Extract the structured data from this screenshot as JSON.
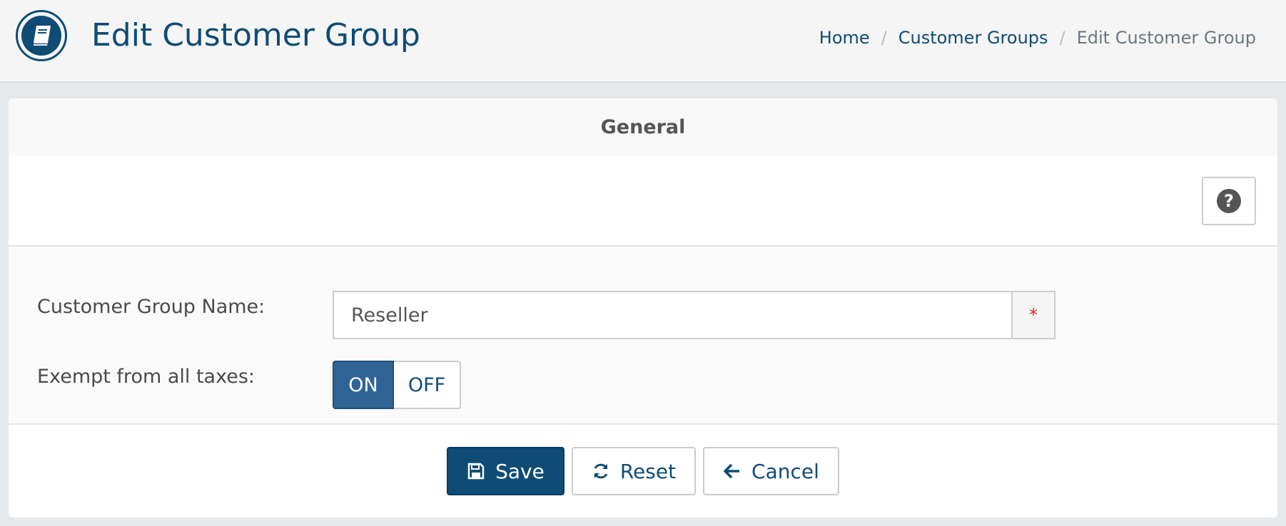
{
  "header": {
    "logo_icon": "book-icon",
    "title": "Edit Customer Group",
    "breadcrumb": [
      {
        "label": "Home"
      },
      {
        "label": "Customer Groups"
      },
      {
        "label": "Edit Customer Group"
      }
    ],
    "breadcrumb_separator": "/"
  },
  "card": {
    "heading": "General",
    "help_icon": "question-circle-icon",
    "help_glyph": "?"
  },
  "form": {
    "group_name_label": "Customer Group Name:",
    "group_name_value": "Reseller",
    "required_marker": "*",
    "exempt_label": "Exempt from all taxes:",
    "exempt_on_label": "ON",
    "exempt_off_label": "OFF",
    "exempt_selected": "ON"
  },
  "actions": {
    "save_label": "Save",
    "save_icon": "floppy-disk-icon",
    "reset_label": "Reset",
    "reset_icon": "refresh-icon",
    "cancel_label": "Cancel",
    "cancel_icon": "arrow-left-icon"
  },
  "colors": {
    "brand": "#0f4c75",
    "switch_on": "#2f6495",
    "required": "#e0202a"
  }
}
